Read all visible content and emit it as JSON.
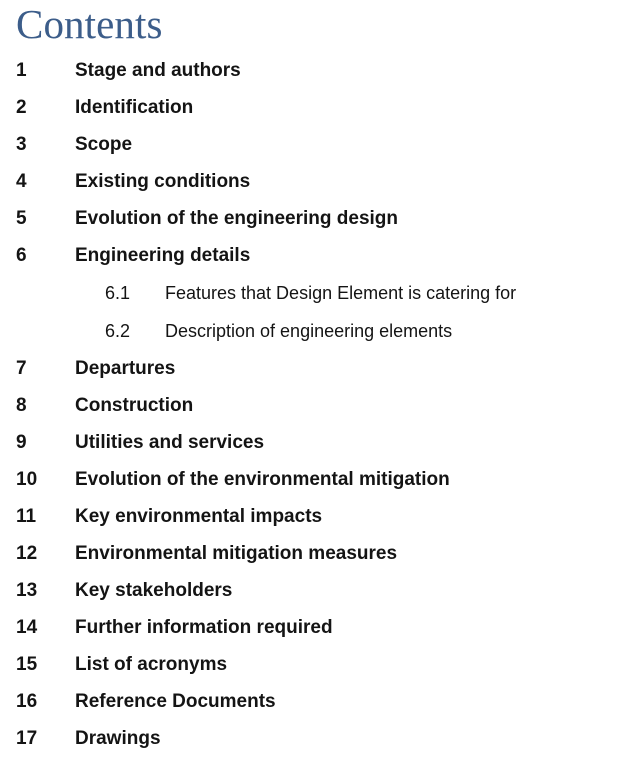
{
  "document": {
    "title": "Contents",
    "title_color": "#3c5d8a",
    "text_color": "#141414",
    "background_color": "#ffffff"
  },
  "contents": {
    "entries": [
      {
        "number": "1",
        "label": "Stage and authors",
        "level": 1
      },
      {
        "number": "2",
        "label": "Identification",
        "level": 1
      },
      {
        "number": "3",
        "label": "Scope",
        "level": 1
      },
      {
        "number": "4",
        "label": "Existing conditions",
        "level": 1
      },
      {
        "number": "5",
        "label": "Evolution of the engineering design",
        "level": 1
      },
      {
        "number": "6",
        "label": "Engineering details",
        "level": 1
      },
      {
        "number": "6.1",
        "label": "Features that Design Element is catering for",
        "level": 2
      },
      {
        "number": "6.2",
        "label": "Description of engineering elements",
        "level": 2
      },
      {
        "number": "7",
        "label": "Departures",
        "level": 1
      },
      {
        "number": "8",
        "label": "Construction",
        "level": 1
      },
      {
        "number": "9",
        "label": "Utilities and services",
        "level": 1
      },
      {
        "number": "10",
        "label": "Evolution of the environmental mitigation",
        "level": 1
      },
      {
        "number": "11",
        "label": "Key environmental impacts",
        "level": 1
      },
      {
        "number": "12",
        "label": "Environmental mitigation measures",
        "level": 1
      },
      {
        "number": "13",
        "label": "Key stakeholders",
        "level": 1
      },
      {
        "number": "14",
        "label": "Further information required",
        "level": 1
      },
      {
        "number": "15",
        "label": "List of acronyms",
        "level": 1
      },
      {
        "number": "16",
        "label": "Reference Documents",
        "level": 1
      },
      {
        "number": "17",
        "label": "Drawings",
        "level": 1
      }
    ]
  }
}
